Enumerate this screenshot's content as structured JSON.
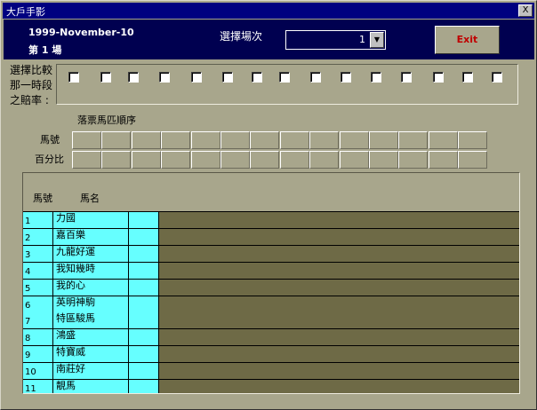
{
  "window": {
    "title": "大戶手影",
    "close_label": "X"
  },
  "header": {
    "date": "1999-November-10",
    "race_label": "第 1 場",
    "select_label": "選擇場次",
    "race_select_value": "1",
    "dropdown_arrow": "▼",
    "exit_label": "Exit"
  },
  "compare": {
    "label_line1": "選擇比較",
    "label_line2": "那一時段",
    "label_line3": "之賠率 :",
    "checkbox_count": 14
  },
  "falling": {
    "title": "落票馬匹順序",
    "horse_no_label": "馬號",
    "percent_label": "百分比"
  },
  "horses": {
    "col_no": "馬號",
    "col_name": "馬名",
    "rows": [
      {
        "no": "1",
        "name": "力國"
      },
      {
        "no": "2",
        "name": "嘉百樂"
      },
      {
        "no": "3",
        "name": "九龍好運"
      },
      {
        "no": "4",
        "name": "我知幾時"
      },
      {
        "no": "5",
        "name": "我的心"
      },
      {
        "no": "6",
        "name": "英明神駒"
      },
      {
        "no": "7",
        "name": "特區駿馬"
      },
      {
        "no": "8",
        "name": "鴻盛"
      },
      {
        "no": "9",
        "name": "特寶威"
      },
      {
        "no": "10",
        "name": "南莊好"
      },
      {
        "no": "11",
        "name": "靚馬"
      }
    ]
  },
  "colors": {
    "title_bar": "#000080",
    "header_bg": "#000050",
    "form_bg": "#a8a68c",
    "cyan_cells": "#66ffff",
    "dark_cells": "#6e6a46",
    "exit_text": "#c00000"
  }
}
